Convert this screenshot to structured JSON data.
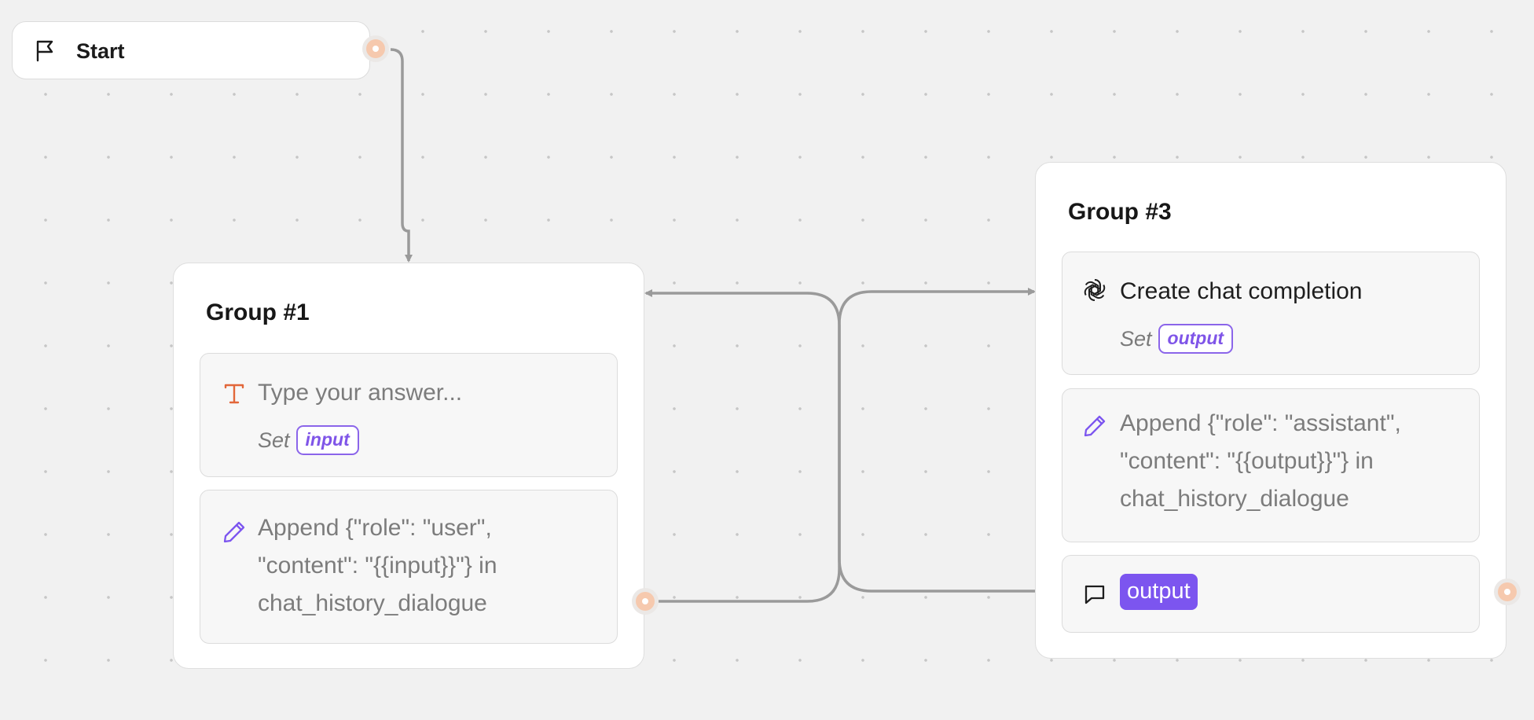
{
  "start": {
    "label": "Start",
    "icon": "flag-icon"
  },
  "groups": [
    {
      "title": "Group #1",
      "blocks": [
        {
          "type": "text-input",
          "icon": "text-input-icon",
          "placeholder_text": "Type your answer...",
          "set_label": "Set",
          "variable": "input"
        },
        {
          "type": "set-variable",
          "icon": "pencil-icon",
          "lines": [
            "Append {\"role\": \"user\",",
            "\"content\": \"{{input}}\"} in",
            "chat_history_dialogue"
          ]
        }
      ]
    },
    {
      "title": "Group #3",
      "blocks": [
        {
          "type": "openai",
          "icon": "openai-icon",
          "label": "Create chat completion",
          "set_label": "Set",
          "variable": "output"
        },
        {
          "type": "set-variable",
          "icon": "pencil-icon",
          "lines": [
            "Append {\"role\": \"assistant\",",
            "\"content\": \"{{output}}\"} in",
            "chat_history_dialogue"
          ]
        },
        {
          "type": "text-bubble",
          "icon": "chat-bubble-icon",
          "variable_tag": "output"
        }
      ]
    }
  ],
  "colors": {
    "accent": "#7c55ef",
    "input_icon": "#e2673a",
    "endpoint": "#f6c9ae",
    "edge": "#9a9a9a",
    "canvas": "#f1f1f1"
  }
}
